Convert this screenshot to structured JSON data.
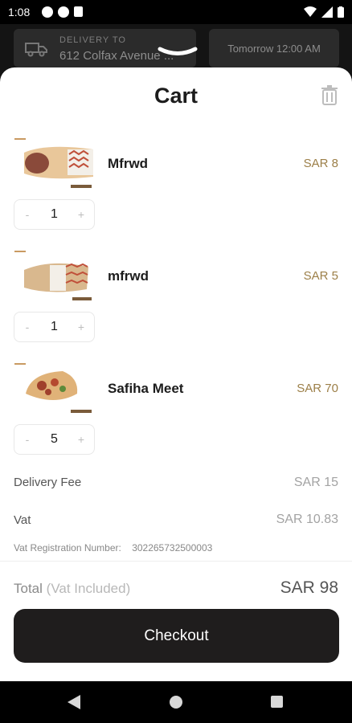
{
  "status_bar": {
    "time": "1:08"
  },
  "header": {
    "delivery_label": "DELIVERY TO",
    "delivery_address": "612 Colfax Avenue ...",
    "delivery_time": "Tomorrow 12:00 AM"
  },
  "cart": {
    "title": "Cart",
    "items": [
      {
        "name": "Mfrwd",
        "price": "SAR 8",
        "qty": "1",
        "image": "shawarma-wrap"
      },
      {
        "name": "mfrwd",
        "price": "SAR 5",
        "qty": "1",
        "image": "shawarma-roll"
      },
      {
        "name": "Safiha Meet",
        "price": "SAR 70",
        "qty": "5",
        "image": "safiha-flatbread"
      }
    ],
    "minus": "-",
    "plus": "+"
  },
  "summary": {
    "delivery_fee_label": "Delivery Fee",
    "delivery_fee": "SAR 15",
    "vat_label": "Vat",
    "vat": "SAR 10.83",
    "vat_reg_label": "Vat Registration Number:",
    "vat_reg_number": "302265732500003",
    "total_label": "Total",
    "total_note": "(Vat Included)",
    "total": "SAR 98"
  },
  "checkout_label": "Checkout",
  "colors": {
    "accent_price": "#9c7f48",
    "button_bg": "#1f1d1d"
  }
}
